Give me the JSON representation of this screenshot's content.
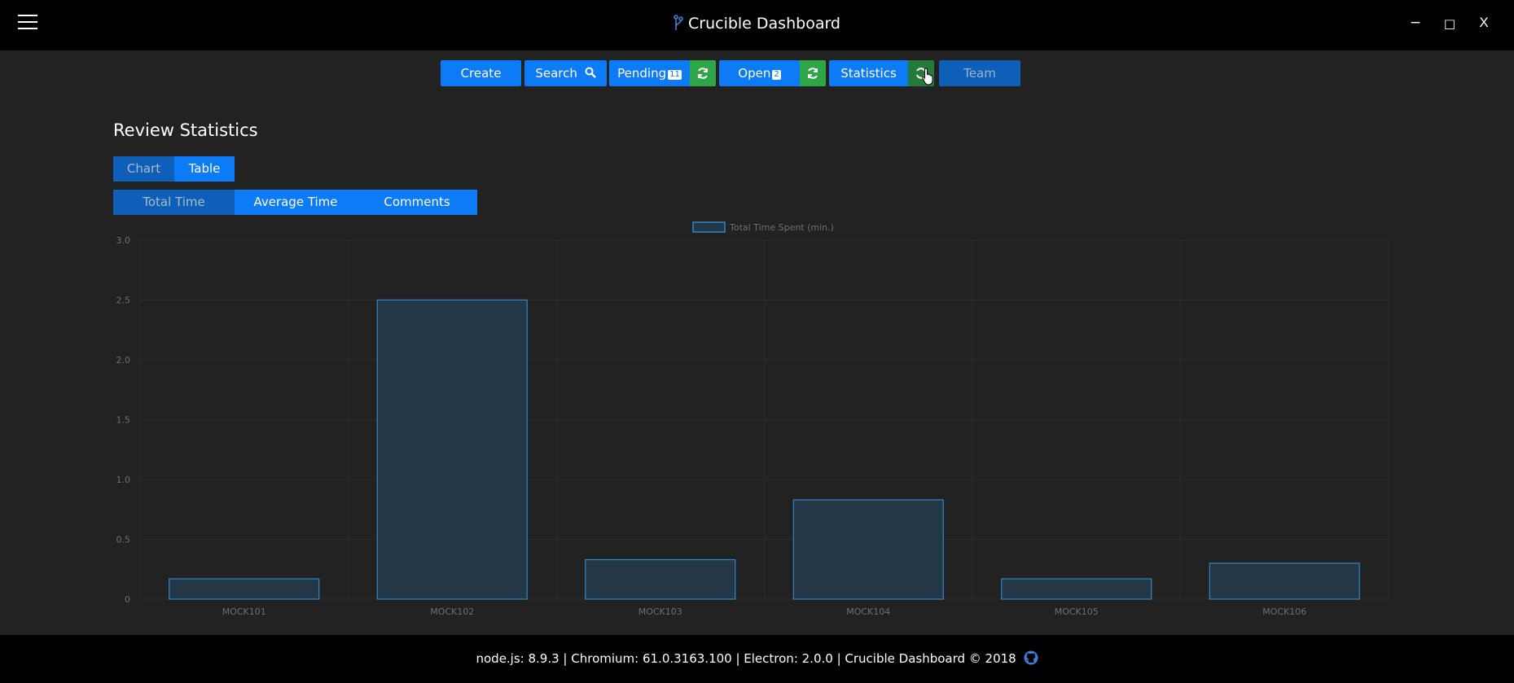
{
  "app": {
    "title": "Crucible Dashboard"
  },
  "window_controls": {
    "minimize": "−",
    "maximize": "□",
    "close": "X"
  },
  "nav": {
    "create": "Create",
    "search": "Search",
    "pending": "Pending",
    "pending_count": "11",
    "open": "Open",
    "open_count": "2",
    "statistics": "Statistics",
    "team": "Team"
  },
  "page": {
    "title": "Review Statistics"
  },
  "view_toggle": {
    "chart": "Chart",
    "table": "Table"
  },
  "metric_tabs": {
    "total_time": "Total Time",
    "average_time": "Average Time",
    "comments": "Comments"
  },
  "colors": {
    "accent": "#0d7af6",
    "refresh": "#2ea646",
    "bar_fill": "#243746",
    "bar_stroke": "#2f86c8"
  },
  "chart_data": {
    "type": "bar",
    "categories": [
      "MOCK101",
      "MOCK102",
      "MOCK103",
      "MOCK104",
      "MOCK105",
      "MOCK106"
    ],
    "series": [
      {
        "name": "Total Time Spent (min.)",
        "values": [
          0.17,
          2.5,
          0.33,
          0.83,
          0.17,
          0.3
        ]
      }
    ],
    "ylim": [
      0,
      3.0
    ],
    "yticks": [
      "0",
      "0.5",
      "1.0",
      "1.5",
      "2.0",
      "2.5",
      "3.0"
    ],
    "legend": "top-center",
    "grid": true
  },
  "footer": {
    "text": "node.js: 8.9.3 | Chromium: 61.0.3163.100 | Electron: 2.0.0 | Crucible Dashboard © 2018"
  }
}
